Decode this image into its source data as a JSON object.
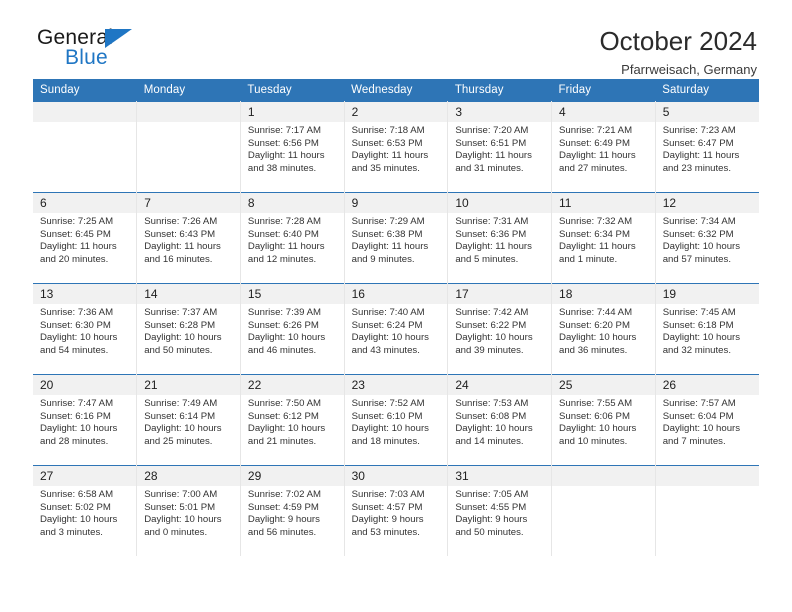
{
  "brand": {
    "name_top": "General",
    "name_bottom": "Blue",
    "triangle_color": "#1f76c4"
  },
  "header": {
    "title": "October 2024",
    "location": "Pfarrweisach, Germany"
  },
  "theme": {
    "header_blue": "#2e75b6",
    "daynum_band": "#f1f1f1",
    "grid_line": "#e6e6e6",
    "text": "#333333"
  },
  "weekday_headers": [
    "Sunday",
    "Monday",
    "Tuesday",
    "Wednesday",
    "Thursday",
    "Friday",
    "Saturday"
  ],
  "labels": {
    "sunrise_prefix": "Sunrise:",
    "sunset_prefix": "Sunset:",
    "daylight_prefix": "Daylight:"
  },
  "weeks": [
    [
      {
        "day": "",
        "blank": true
      },
      {
        "day": "",
        "blank": true
      },
      {
        "day": "1",
        "sunrise": "Sunrise: 7:17 AM",
        "sunset": "Sunset: 6:56 PM",
        "daylight1": "Daylight: 11 hours",
        "daylight2": "and 38 minutes."
      },
      {
        "day": "2",
        "sunrise": "Sunrise: 7:18 AM",
        "sunset": "Sunset: 6:53 PM",
        "daylight1": "Daylight: 11 hours",
        "daylight2": "and 35 minutes."
      },
      {
        "day": "3",
        "sunrise": "Sunrise: 7:20 AM",
        "sunset": "Sunset: 6:51 PM",
        "daylight1": "Daylight: 11 hours",
        "daylight2": "and 31 minutes."
      },
      {
        "day": "4",
        "sunrise": "Sunrise: 7:21 AM",
        "sunset": "Sunset: 6:49 PM",
        "daylight1": "Daylight: 11 hours",
        "daylight2": "and 27 minutes."
      },
      {
        "day": "5",
        "sunrise": "Sunrise: 7:23 AM",
        "sunset": "Sunset: 6:47 PM",
        "daylight1": "Daylight: 11 hours",
        "daylight2": "and 23 minutes."
      }
    ],
    [
      {
        "day": "6",
        "sunrise": "Sunrise: 7:25 AM",
        "sunset": "Sunset: 6:45 PM",
        "daylight1": "Daylight: 11 hours",
        "daylight2": "and 20 minutes."
      },
      {
        "day": "7",
        "sunrise": "Sunrise: 7:26 AM",
        "sunset": "Sunset: 6:43 PM",
        "daylight1": "Daylight: 11 hours",
        "daylight2": "and 16 minutes."
      },
      {
        "day": "8",
        "sunrise": "Sunrise: 7:28 AM",
        "sunset": "Sunset: 6:40 PM",
        "daylight1": "Daylight: 11 hours",
        "daylight2": "and 12 minutes."
      },
      {
        "day": "9",
        "sunrise": "Sunrise: 7:29 AM",
        "sunset": "Sunset: 6:38 PM",
        "daylight1": "Daylight: 11 hours",
        "daylight2": "and 9 minutes."
      },
      {
        "day": "10",
        "sunrise": "Sunrise: 7:31 AM",
        "sunset": "Sunset: 6:36 PM",
        "daylight1": "Daylight: 11 hours",
        "daylight2": "and 5 minutes."
      },
      {
        "day": "11",
        "sunrise": "Sunrise: 7:32 AM",
        "sunset": "Sunset: 6:34 PM",
        "daylight1": "Daylight: 11 hours",
        "daylight2": "and 1 minute."
      },
      {
        "day": "12",
        "sunrise": "Sunrise: 7:34 AM",
        "sunset": "Sunset: 6:32 PM",
        "daylight1": "Daylight: 10 hours",
        "daylight2": "and 57 minutes."
      }
    ],
    [
      {
        "day": "13",
        "sunrise": "Sunrise: 7:36 AM",
        "sunset": "Sunset: 6:30 PM",
        "daylight1": "Daylight: 10 hours",
        "daylight2": "and 54 minutes."
      },
      {
        "day": "14",
        "sunrise": "Sunrise: 7:37 AM",
        "sunset": "Sunset: 6:28 PM",
        "daylight1": "Daylight: 10 hours",
        "daylight2": "and 50 minutes."
      },
      {
        "day": "15",
        "sunrise": "Sunrise: 7:39 AM",
        "sunset": "Sunset: 6:26 PM",
        "daylight1": "Daylight: 10 hours",
        "daylight2": "and 46 minutes."
      },
      {
        "day": "16",
        "sunrise": "Sunrise: 7:40 AM",
        "sunset": "Sunset: 6:24 PM",
        "daylight1": "Daylight: 10 hours",
        "daylight2": "and 43 minutes."
      },
      {
        "day": "17",
        "sunrise": "Sunrise: 7:42 AM",
        "sunset": "Sunset: 6:22 PM",
        "daylight1": "Daylight: 10 hours",
        "daylight2": "and 39 minutes."
      },
      {
        "day": "18",
        "sunrise": "Sunrise: 7:44 AM",
        "sunset": "Sunset: 6:20 PM",
        "daylight1": "Daylight: 10 hours",
        "daylight2": "and 36 minutes."
      },
      {
        "day": "19",
        "sunrise": "Sunrise: 7:45 AM",
        "sunset": "Sunset: 6:18 PM",
        "daylight1": "Daylight: 10 hours",
        "daylight2": "and 32 minutes."
      }
    ],
    [
      {
        "day": "20",
        "sunrise": "Sunrise: 7:47 AM",
        "sunset": "Sunset: 6:16 PM",
        "daylight1": "Daylight: 10 hours",
        "daylight2": "and 28 minutes."
      },
      {
        "day": "21",
        "sunrise": "Sunrise: 7:49 AM",
        "sunset": "Sunset: 6:14 PM",
        "daylight1": "Daylight: 10 hours",
        "daylight2": "and 25 minutes."
      },
      {
        "day": "22",
        "sunrise": "Sunrise: 7:50 AM",
        "sunset": "Sunset: 6:12 PM",
        "daylight1": "Daylight: 10 hours",
        "daylight2": "and 21 minutes."
      },
      {
        "day": "23",
        "sunrise": "Sunrise: 7:52 AM",
        "sunset": "Sunset: 6:10 PM",
        "daylight1": "Daylight: 10 hours",
        "daylight2": "and 18 minutes."
      },
      {
        "day": "24",
        "sunrise": "Sunrise: 7:53 AM",
        "sunset": "Sunset: 6:08 PM",
        "daylight1": "Daylight: 10 hours",
        "daylight2": "and 14 minutes."
      },
      {
        "day": "25",
        "sunrise": "Sunrise: 7:55 AM",
        "sunset": "Sunset: 6:06 PM",
        "daylight1": "Daylight: 10 hours",
        "daylight2": "and 10 minutes."
      },
      {
        "day": "26",
        "sunrise": "Sunrise: 7:57 AM",
        "sunset": "Sunset: 6:04 PM",
        "daylight1": "Daylight: 10 hours",
        "daylight2": "and 7 minutes."
      }
    ],
    [
      {
        "day": "27",
        "sunrise": "Sunrise: 6:58 AM",
        "sunset": "Sunset: 5:02 PM",
        "daylight1": "Daylight: 10 hours",
        "daylight2": "and 3 minutes."
      },
      {
        "day": "28",
        "sunrise": "Sunrise: 7:00 AM",
        "sunset": "Sunset: 5:01 PM",
        "daylight1": "Daylight: 10 hours",
        "daylight2": "and 0 minutes."
      },
      {
        "day": "29",
        "sunrise": "Sunrise: 7:02 AM",
        "sunset": "Sunset: 4:59 PM",
        "daylight1": "Daylight: 9 hours",
        "daylight2": "and 56 minutes."
      },
      {
        "day": "30",
        "sunrise": "Sunrise: 7:03 AM",
        "sunset": "Sunset: 4:57 PM",
        "daylight1": "Daylight: 9 hours",
        "daylight2": "and 53 minutes."
      },
      {
        "day": "31",
        "sunrise": "Sunrise: 7:05 AM",
        "sunset": "Sunset: 4:55 PM",
        "daylight1": "Daylight: 9 hours",
        "daylight2": "and 50 minutes."
      },
      {
        "day": "",
        "blank": true
      },
      {
        "day": "",
        "blank": true
      }
    ]
  ]
}
